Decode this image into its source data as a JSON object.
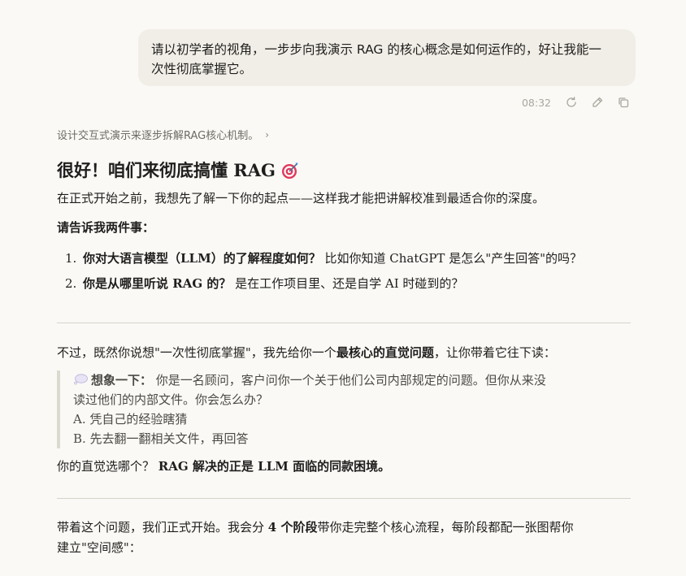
{
  "user_message": {
    "line1": "请以初学者的视角，一步步向我演示 RAG 的核心概念是如何运作的，好让我能一",
    "line2": "次性彻底掌握它。"
  },
  "message_actions": {
    "timestamp": "08:32",
    "icons": [
      "retry-icon",
      "edit-icon",
      "copy-icon"
    ]
  },
  "thinking_summary": {
    "text": "设计交互式演示来逐步拆解RAG核心机制。",
    "chevron": "›"
  },
  "response": {
    "heading": "很好！咱们来彻底搞懂 RAG",
    "intro": "在正式开始之前，我想先了解一下你的起点——这样我才能把讲解校准到最适合你的深度。",
    "ask_label": "请告诉我两件事：",
    "questions": [
      {
        "num": "1.",
        "bold": "你对大语言模型（LLM）的了解程度如何？",
        "rest": " 比如你知道 ChatGPT 是怎么\"产生回答\"的吗？"
      },
      {
        "num": "2.",
        "bold": "你是从哪里听说 RAG 的？",
        "rest": " 是在工作项目里、还是自学 AI 时碰到的？"
      }
    ],
    "section2": {
      "lead_pre": "不过，既然你说想\"一次性彻底掌握\"，我先给你一个",
      "lead_bold": "最核心的直觉问题",
      "lead_post": "，让你带着它往下读：",
      "quote_bold": "想象一下：",
      "quote_rest_1": " 你是一名顾问，客户问你一个关于他们公司内部规定的问题。但你从来没",
      "quote_rest_2": "读过他们的内部文件。你会怎么办？",
      "option_a": "A. 凭自己的经验瞎猜",
      "option_b": "B. 先去翻一翻相关文件，再回答",
      "after_pre": "你的直觉选哪个？",
      "after_bold": "RAG 解决的正是 LLM 面临的同款困境。"
    },
    "section3": {
      "pre": "带着这个问题，我们正式开始。我会分 ",
      "bold": "4 个阶段",
      "post_1": "带你走完整个核心流程，每阶段都配一张图帮你",
      "post_2": "建立\"空间感\"："
    }
  },
  "colors": {
    "background": "#faf9f5",
    "user_bubble": "#f0eee6",
    "muted_text": "#a9a69d",
    "rule": "#d6d3ca",
    "quote_border": "#dcd9d0"
  }
}
